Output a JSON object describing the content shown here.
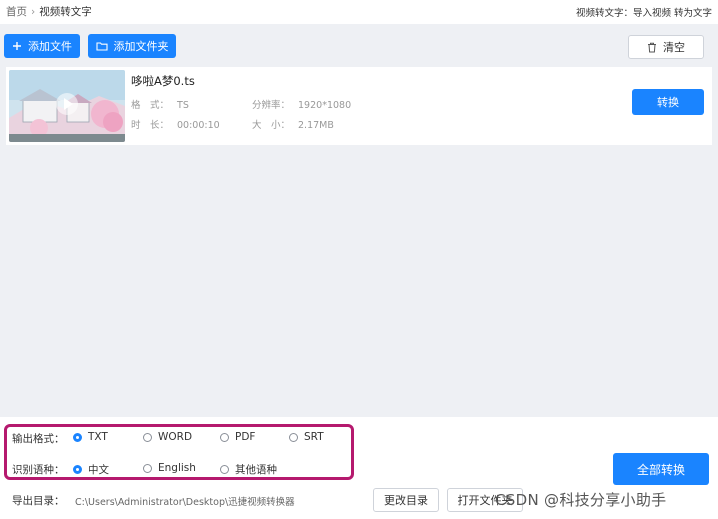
{
  "breadcrumb": {
    "home": "首页",
    "separator": "›",
    "current": "视频转文字"
  },
  "hint_text": "视频转文字：导入视频 转为文字",
  "toolbar": {
    "add_file": "添加文件",
    "add_folder": "添加文件夹",
    "clear": "清空"
  },
  "file": {
    "name": "哆啦A梦0.ts",
    "format_label": "格　式：",
    "format_value": "TS",
    "resolution_label": "分辨率：",
    "resolution_value": "1920*1080",
    "duration_label": "时　长：",
    "duration_value": "00:00:10",
    "size_label": "大　小：",
    "size_value": "2.17MB",
    "convert_button": "转换"
  },
  "output_format": {
    "label": "输出格式：",
    "options": [
      "TXT",
      "WORD",
      "PDF",
      "SRT"
    ],
    "selected": "TXT"
  },
  "language": {
    "label": "识别语种：",
    "options": [
      "中文",
      "English",
      "其他语种"
    ],
    "selected": "中文"
  },
  "export": {
    "label": "导出目录：",
    "path": "C:\\Users\\Administrator\\Desktop\\迅捷视频转换器",
    "change_dir": "更改目录",
    "open_folder": "打开文件夹"
  },
  "convert_all": "全部转换",
  "watermark": "CSDN @科技分享小助手",
  "colors": {
    "accent": "#1a84ff",
    "highlight": "#b5196e",
    "panel_bg": "#eef0f4"
  }
}
